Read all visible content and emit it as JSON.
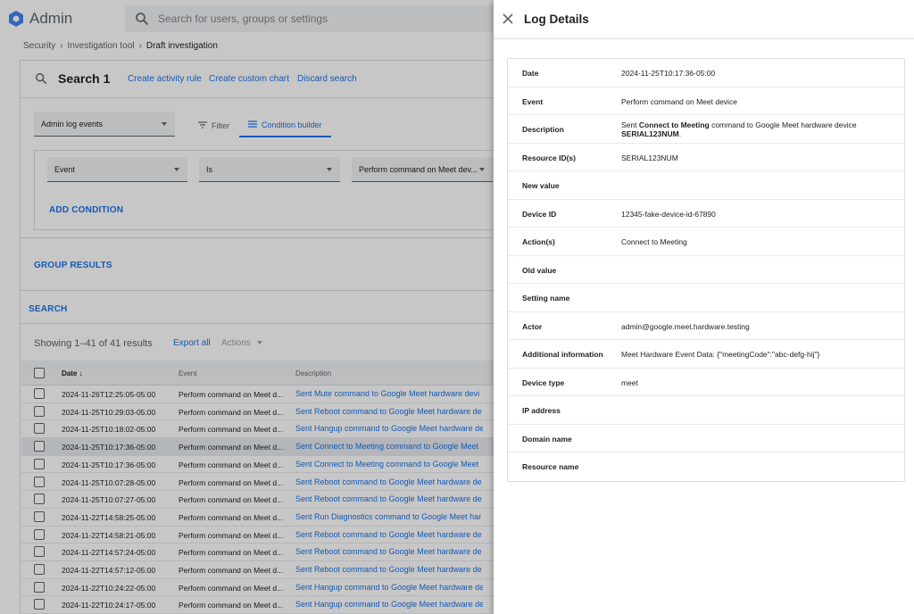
{
  "app": {
    "title": "Admin",
    "search_placeholder": "Search for users, groups or settings"
  },
  "breadcrumb": {
    "items": [
      "Security",
      "Investigation tool",
      "Draft investigation"
    ]
  },
  "search_card": {
    "title": "Search 1",
    "links": [
      "Create activity rule",
      "Create custom chart",
      "Discard search"
    ],
    "data_source": "Admin log events",
    "tabs": [
      "Filter",
      "Condition builder"
    ],
    "condition": {
      "field": "Event",
      "operator": "Is",
      "value": "Perform command on Meet dev..."
    },
    "add_condition": "ADD CONDITION",
    "group_results": "GROUP RESULTS",
    "search_button": "SEARCH"
  },
  "results": {
    "summary": "Showing 1–41 of 41 results",
    "export_label": "Export all",
    "actions_label": "Actions",
    "columns": [
      "Date",
      "Event",
      "Description"
    ],
    "rows": [
      {
        "date": "2024-11-26T12:25:05-05:00",
        "event": "Perform command on Meet d...",
        "description": "Sent Mute command to Google Meet hardware devi"
      },
      {
        "date": "2024-11-25T10:29:03-05:00",
        "event": "Perform command on Meet d...",
        "description": "Sent Reboot command to Google Meet hardware de"
      },
      {
        "date": "2024-11-25T10:18:02-05:00",
        "event": "Perform command on Meet d...",
        "description": "Sent Hangup command to Google Meet hardware de"
      },
      {
        "date": "2024-11-25T10:17:36-05:00",
        "event": "Perform command on Meet d...",
        "description": "Sent Connect to Meeting command to Google Meet"
      },
      {
        "date": "2024-11-25T10:17:36-05:00",
        "event": "Perform command on Meet d...",
        "description": "Sent Connect to Meeting command to Google Meet"
      },
      {
        "date": "2024-11-25T10:07:28-05:00",
        "event": "Perform command on Meet d...",
        "description": "Sent Reboot command to Google Meet hardware de"
      },
      {
        "date": "2024-11-25T10:07:27-05:00",
        "event": "Perform command on Meet d...",
        "description": "Sent Reboot command to Google Meet hardware de"
      },
      {
        "date": "2024-11-22T14:58:25-05:00",
        "event": "Perform command on Meet d...",
        "description": "Sent Run Diagnostics command to Google Meet har"
      },
      {
        "date": "2024-11-22T14:58:21-05:00",
        "event": "Perform command on Meet d...",
        "description": "Sent Reboot command to Google Meet hardware de"
      },
      {
        "date": "2024-11-22T14:57:24-05:00",
        "event": "Perform command on Meet d...",
        "description": "Sent Reboot command to Google Meet hardware de"
      },
      {
        "date": "2024-11-22T14:57:12-05:00",
        "event": "Perform command on Meet d...",
        "description": "Sent Reboot command to Google Meet hardware de"
      },
      {
        "date": "2024-11-22T10:24:22-05:00",
        "event": "Perform command on Meet d...",
        "description": "Sent Hangup command to Google Meet hardware de"
      },
      {
        "date": "2024-11-22T10:24:17-05:00",
        "event": "Perform command on Meet d...",
        "description": "Sent Hangup command to Google Meet hardware de"
      }
    ]
  },
  "log_details": {
    "title": "Log Details",
    "rows": [
      {
        "label": "Date",
        "value": "2024-11-25T10:17:36-05:00"
      },
      {
        "label": "Event",
        "value": "Perform command on Meet device"
      },
      {
        "label": "Description",
        "value_prefix": "Sent ",
        "value_bold": "Connect to Meeting",
        "value_middle": " command to Google Meet hardware device ",
        "value_bold2": "SERIAL123NUM",
        "value_suffix": "."
      },
      {
        "label": "Resource ID(s)",
        "value": "SERIAL123NUM"
      },
      {
        "label": "New value",
        "value": ""
      },
      {
        "label": "Device ID",
        "value": "12345-fake-device-id-67890"
      },
      {
        "label": "Action(s)",
        "value": "Connect to Meeting"
      },
      {
        "label": "Old value",
        "value": ""
      },
      {
        "label": "Setting name",
        "value": ""
      },
      {
        "label": "Actor",
        "value": "admin@google.meet.hardware.testing"
      },
      {
        "label": "Additional information",
        "value": "Meet Hardware Event Data: {\"meetingCode\":\"abc-defg-hij\"}"
      },
      {
        "label": "Device type",
        "value": "meet"
      },
      {
        "label": "IP address",
        "value": ""
      },
      {
        "label": "Domain name",
        "value": ""
      },
      {
        "label": "Resource name",
        "value": ""
      }
    ]
  },
  "colors": {
    "accent": "#1a73e8",
    "logo": "#4285f4",
    "text": "#202124",
    "muted": "#5f6368"
  }
}
